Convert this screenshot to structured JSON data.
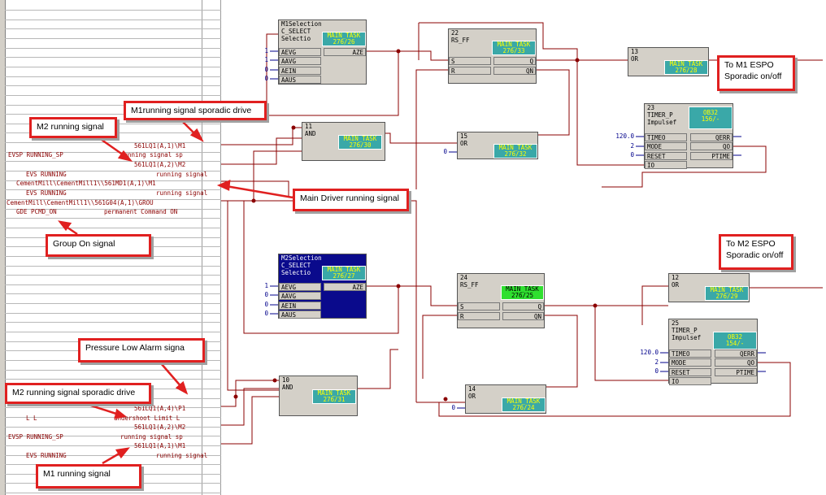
{
  "left_panel": {
    "signals": [
      "561LQ1(A,1)\\M1",
      "EVSP RUNNING_SP",
      "running signal sp",
      "561LQ1(A,2)\\M2",
      "EVS RUNNING",
      "running signal",
      "CementMill\\CementMill1\\\\561MD1(A,1)\\M1",
      "EVS RUNNING",
      "running signal",
      "CementMill\\CementMill1\\\\561G04(A,1)\\GROU",
      "GDE PCMD_ON",
      "permanent Command ON",
      "561LQ1(A,4)\\P1",
      "L L",
      "undershoot Limit L",
      "561LQ1(A,2)\\M2",
      "EVSP RUNNING_SP",
      "running signal sp",
      "561LQ1(A,1)\\M1",
      "EVS RUNNING",
      "running signal"
    ]
  },
  "blocks": {
    "m1sel": {
      "num": "M1Selection",
      "name": "C_SELECT",
      "sub": "Selectio",
      "task": "MAIN_TASK",
      "tasknum": "276/26",
      "ins": [
        "AEVG",
        "AAVG",
        "AEIN",
        "AAUS"
      ],
      "outs": [
        "AZE"
      ],
      "vals": [
        "1",
        "1",
        "0",
        "0"
      ]
    },
    "b22": {
      "num": "22",
      "name": "RS_FF",
      "task": "MAIN_TASK",
      "tasknum": "276/33",
      "ins": [
        "S",
        "R"
      ],
      "outs": [
        "Q",
        "QN"
      ]
    },
    "b13": {
      "num": "13",
      "name": "OR",
      "task": "MAIN_TASK",
      "tasknum": "276/28"
    },
    "b11": {
      "num": "11",
      "name": "AND",
      "task": "MAIN_TASK",
      "tasknum": "276/30"
    },
    "b15": {
      "num": "15",
      "name": "OR",
      "task": "MAIN_TASK",
      "tasknum": "276/32",
      "vals": [
        "0"
      ]
    },
    "b23": {
      "num": "23",
      "name": "TIMER_P",
      "sub": "Impulsef",
      "task": "OB32",
      "tasknum": "156/-",
      "ins": [
        "TIMEO",
        "MODE",
        "RESET",
        "IO"
      ],
      "outs": [
        "QERR",
        "QO",
        "PTIME"
      ],
      "vals": [
        "120.0",
        "2",
        "0"
      ]
    },
    "m2sel": {
      "num": "M2Selection",
      "name": "C_SELECT",
      "sub": "Selectio",
      "task": "MAIN_TASK",
      "tasknum": "276/27",
      "ins": [
        "AEVG",
        "AAVG",
        "AEIN",
        "AAUS"
      ],
      "outs": [
        "AZE"
      ],
      "vals": [
        "1",
        "0",
        "0",
        "0"
      ]
    },
    "b24": {
      "num": "24",
      "name": "RS_FF",
      "task": "MAIN_TASK",
      "tasknum": "276/25",
      "ins": [
        "S",
        "R"
      ],
      "outs": [
        "Q",
        "QN"
      ]
    },
    "b12": {
      "num": "12",
      "name": "OR",
      "task": "MAIN_TASK",
      "tasknum": "276/29"
    },
    "b25": {
      "num": "25",
      "name": "TIMER_P",
      "sub": "Impulsef",
      "task": "OB32",
      "tasknum": "154/-",
      "ins": [
        "TIMEO",
        "MODE",
        "RESET",
        "IO"
      ],
      "outs": [
        "QERR",
        "QO",
        "PTIME"
      ],
      "vals": [
        "120.0",
        "2",
        "0"
      ]
    },
    "b10": {
      "num": "10",
      "name": "AND",
      "task": "MAIN_TASK",
      "tasknum": "276/31"
    },
    "b14": {
      "num": "14",
      "name": "OR",
      "task": "MAIN_TASK",
      "tasknum": "276/24",
      "vals": [
        "0"
      ]
    }
  },
  "callouts": {
    "m1_sporadic": "M1running signal sporadic drive",
    "m2_running": "M2 running signal",
    "main_driver": "Main Driver running signal",
    "group_on": "Group On signal",
    "to_m1": "To M1 ESPO Sporadic on/off",
    "to_m2": "To M2 ESPO Sporadic on/off",
    "pressure_low": "Pressure Low Alarm signa",
    "m2_sporadic": "M2 running signal sporadic drive",
    "m1_running": "M1 running signal"
  },
  "colors": {
    "wire": "#8b0000",
    "callout_border": "#e02020",
    "task_teal": "#3aa8a8",
    "task_green": "#2fe02f",
    "selected_block": "#0a0a8c"
  }
}
